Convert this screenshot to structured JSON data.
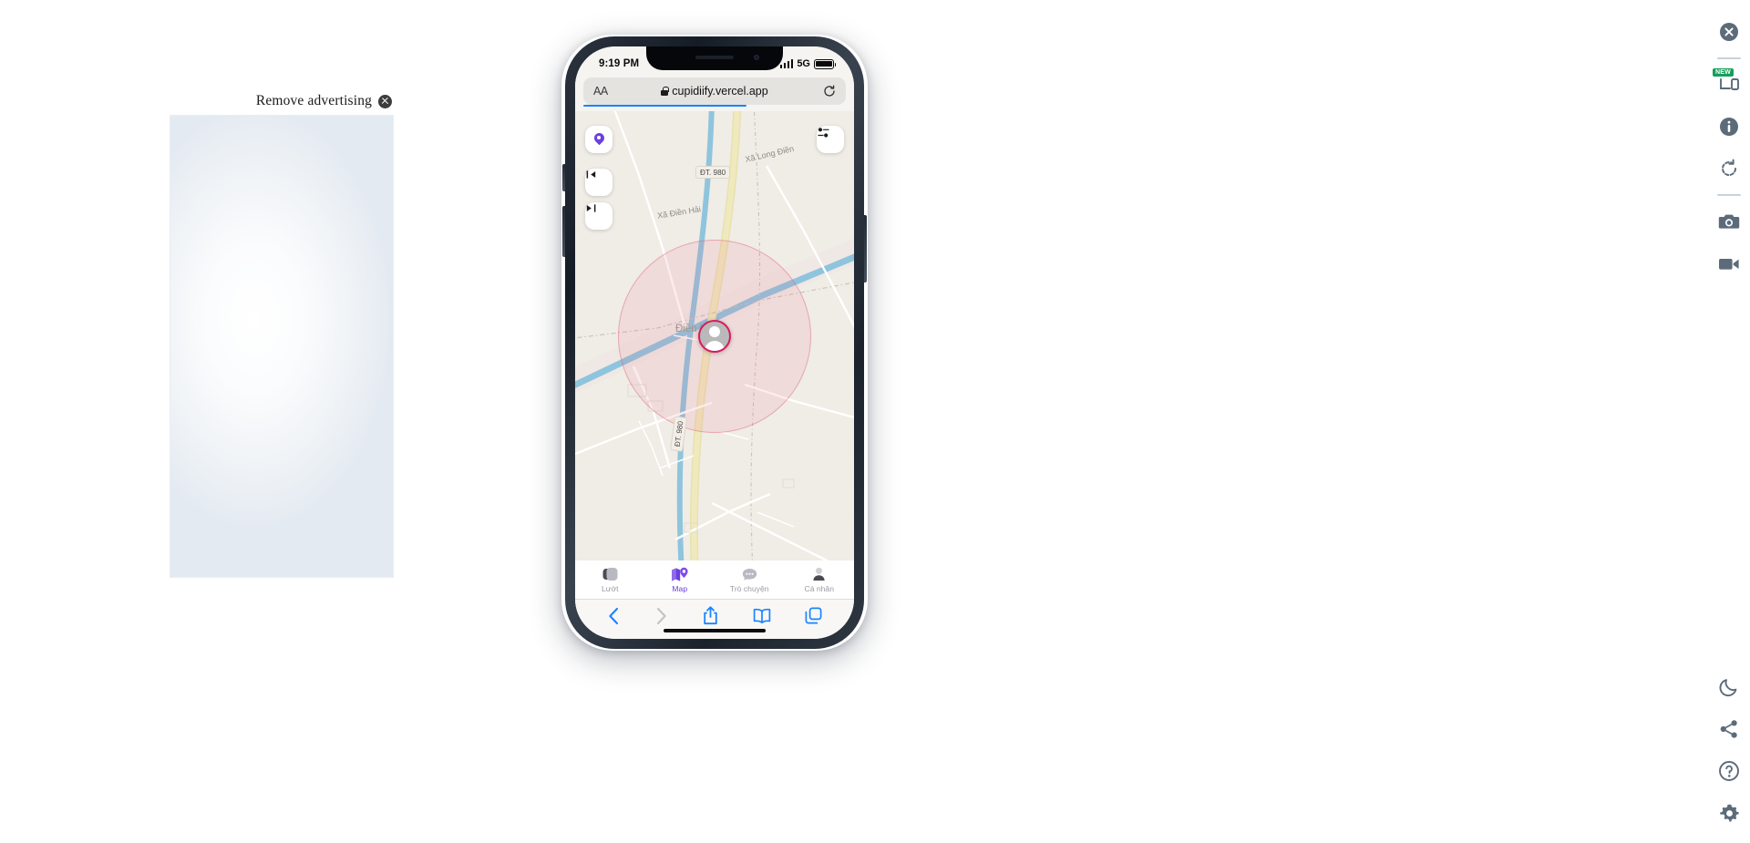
{
  "ad": {
    "remove_label": "Remove advertising",
    "close_icon": "close-circle-icon"
  },
  "phone": {
    "status_bar": {
      "time": "9:19 PM",
      "network": "5G",
      "signal_icon": "cellular-bars-icon",
      "battery_icon": "battery-full-icon"
    },
    "browser": {
      "aa_label": "AA",
      "lock_icon": "lock-icon",
      "url": "cupidiify.vercel.app",
      "reload_icon": "reload-icon",
      "toolbar": {
        "back_icon": "chevron-left-icon",
        "forward_icon": "chevron-right-icon",
        "share_icon": "share-icon",
        "bookmarks_icon": "book-icon",
        "tabs_icon": "tabs-icon"
      }
    }
  },
  "map": {
    "controls": {
      "locate_icon": "map-pin-icon",
      "zoom_out_icon": "collapse-icon",
      "recenter_icon": "recenter-icon",
      "filter_icon": "filter-settings-icon"
    },
    "labels": {
      "road_badge": "ĐT. 980",
      "road_vertical": "ĐT. 980",
      "area_long_dien": "Xã Long Điền",
      "area_dien_hai": "Xã Điền Hải",
      "place_center": "Điền Hải"
    },
    "user_marker": {
      "avatar_icon": "user-avatar-icon",
      "ring_color": "#d81b60"
    }
  },
  "app_tabs": [
    {
      "label": "Lướt",
      "icon": "cards-swipe-icon",
      "active": false
    },
    {
      "label": "Map",
      "icon": "map-pin-icon",
      "active": true
    },
    {
      "label": "Trò chuyện",
      "icon": "chat-bubble-icon",
      "active": false
    },
    {
      "label": "Cá nhân",
      "icon": "person-icon",
      "active": false
    }
  ],
  "right_rail": [
    {
      "icon": "close-circle-icon",
      "name": "close-button"
    },
    {
      "icon": "device-toggle-icon",
      "name": "device-toggle-button",
      "badge": "NEW"
    },
    {
      "icon": "info-icon",
      "name": "info-button"
    },
    {
      "icon": "rotate-icon",
      "name": "rotate-button"
    },
    {
      "icon": "camera-icon",
      "name": "screenshot-button"
    },
    {
      "icon": "video-icon",
      "name": "record-button"
    },
    {
      "icon": "moon-icon",
      "name": "dark-mode-button"
    },
    {
      "icon": "share-icon",
      "name": "share-button"
    },
    {
      "icon": "help-icon",
      "name": "help-button"
    },
    {
      "icon": "gear-icon",
      "name": "settings-button"
    }
  ],
  "theme": {
    "accent": "#6c3fe0",
    "safari_blue": "#1a84ff",
    "map_bg": "#f0ece6",
    "marker_ring": "#d81b60"
  }
}
